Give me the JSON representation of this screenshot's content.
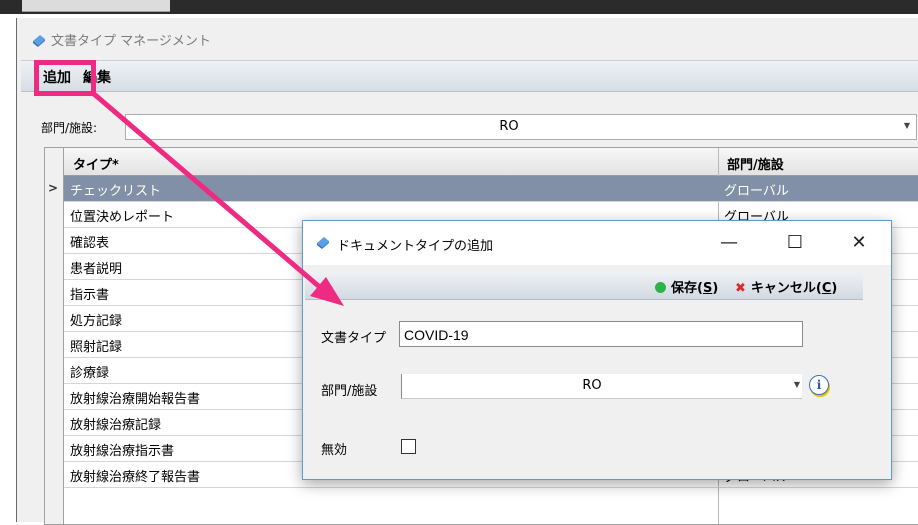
{
  "main_window": {
    "title": "文書タイプ マネージメント",
    "menu": {
      "add": "追加",
      "edit": "編集"
    }
  },
  "filter": {
    "label": "部門/施設:",
    "value": "RO"
  },
  "grid": {
    "columns": [
      "タイプ*",
      "部門/施設"
    ],
    "rows": [
      {
        "type": "チェックリスト",
        "dept": "グローバル",
        "selected": true
      },
      {
        "type": "位置決めレポート",
        "dept": "グローバル"
      },
      {
        "type": "確認表",
        "dept": ""
      },
      {
        "type": "患者説明",
        "dept": ""
      },
      {
        "type": "指示書",
        "dept": ""
      },
      {
        "type": "処方記録",
        "dept": ""
      },
      {
        "type": "照射記録",
        "dept": ""
      },
      {
        "type": "診療録",
        "dept": ""
      },
      {
        "type": "放射線治療開始報告書",
        "dept": ""
      },
      {
        "type": "放射線治療記録",
        "dept": ""
      },
      {
        "type": "放射線治療指示書",
        "dept": ""
      },
      {
        "type": "放射線治療終了報告書",
        "dept": "グローバル"
      }
    ],
    "selected_indicator": ">"
  },
  "dialog": {
    "title": "ドキュメントタイプの追加",
    "minimize": "—",
    "maximize": "☐",
    "close": "✕",
    "save_label": "保存(",
    "save_key": "S",
    "cancel_label": "キャンセル(",
    "cancel_key": "C",
    "close_paren": ")",
    "doc_type_label": "文書タイプ",
    "doc_type_value": "COVID-19",
    "dept_label": "部門/施設",
    "dept_value": "RO",
    "disabled_label": "無効",
    "info_glyph": "i"
  },
  "colors": {
    "highlight": "#ee2a82",
    "selected_row": "#8190a6",
    "dialog_border": "#5b9bd5"
  }
}
